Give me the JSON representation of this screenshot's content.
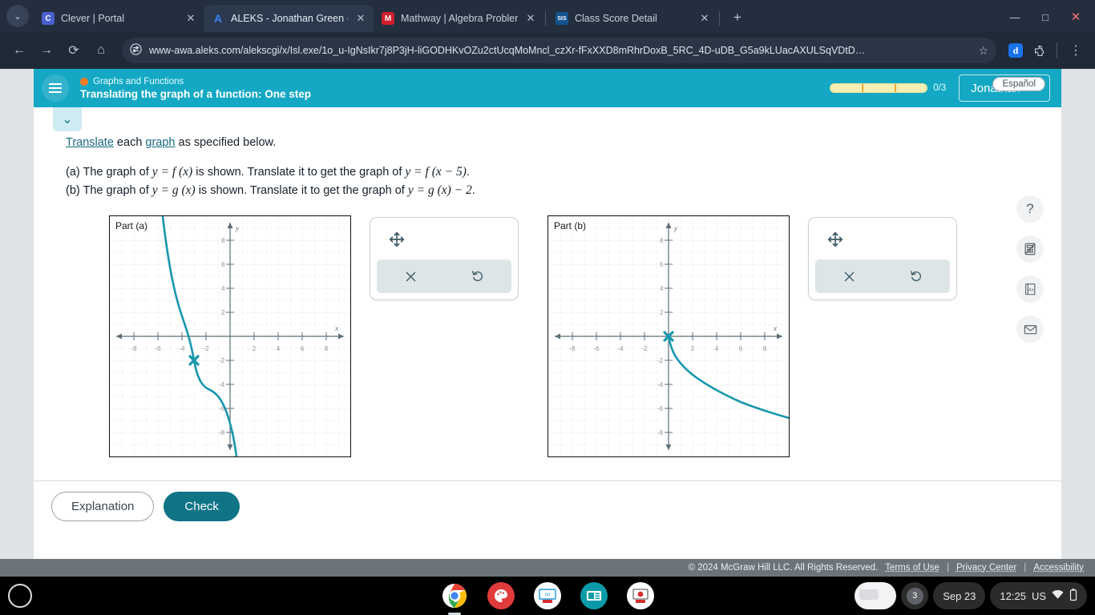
{
  "browser": {
    "tabs": [
      {
        "title": "Clever | Portal",
        "favicon_letter": "C",
        "favicon_color": "#4a5fd0",
        "active": false
      },
      {
        "title": "ALEKS - Jonathan Green - Lear",
        "favicon_letter": "A",
        "favicon_color": "#2b3a4d",
        "active": true
      },
      {
        "title": "Mathway | Algebra Problem So",
        "favicon_letter": "M",
        "favicon_color": "#d11f2b",
        "active": false
      },
      {
        "title": "Class Score Detail",
        "favicon_letter": "SIS",
        "favicon_color": "#12538f",
        "active": false
      }
    ],
    "new_tab_label": "+",
    "nav": {
      "back": "←",
      "forward": "→",
      "reload": "⟳",
      "home": "⌂"
    },
    "url": "www-awa.aleks.com/alekscgi/x/Isl.exe/1o_u-IgNsIkr7j8P3jH-liGODHKvOZu2ctUcqMoMncl_czXr-fFxXXD8mRhrDoxB_5RC_4D-uDB_G5a9kLUacAXULSqVDtD…",
    "bookmark_label": "☆",
    "extension_label": "d",
    "menu_label": "⋮",
    "window_controls": {
      "minimize": "—",
      "maximize": "□",
      "close": "✕"
    }
  },
  "aleks": {
    "topic": "Graphs and Functions",
    "lesson": "Translating the graph of a function: One step",
    "progress": {
      "count_label": "0/3",
      "segments": 3,
      "filled": 0
    },
    "user": "Jonathan",
    "espanol": "Español",
    "collapse_icon": "⌄",
    "question": {
      "intro_link1": "Translate",
      "intro_mid": " each ",
      "intro_link2": "graph",
      "intro_end": " as specified below.",
      "part_a": {
        "marker": "(a) ",
        "text1": "The graph of ",
        "eq1": "y = f (x)",
        "text2": " is shown. Translate it to get the graph of ",
        "eq2": "y = f (x − 5)",
        "end": "."
      },
      "part_b": {
        "marker": "(b) ",
        "text1": "The graph of ",
        "eq1": "y = g (x)",
        "text2": " is shown. Translate it to get the graph of ",
        "eq2": "y = g (x) − 2",
        "end": "."
      }
    },
    "graphs": [
      {
        "label": "Part (a)"
      },
      {
        "label": "Part (b)"
      }
    ],
    "tool_panels": [
      {
        "move_icon": "move-icon",
        "clear_icon": "✕",
        "undo_icon": "↺"
      },
      {
        "move_icon": "move-icon",
        "clear_icon": "✕",
        "undo_icon": "↺"
      }
    ],
    "side_tools": [
      {
        "name": "help-icon",
        "glyph": "?"
      },
      {
        "name": "calculator-disabled-icon",
        "glyph": ""
      },
      {
        "name": "dictionary-icon",
        "glyph": "Aa"
      },
      {
        "name": "mail-icon",
        "glyph": "✉"
      }
    ],
    "buttons": {
      "explanation": "Explanation",
      "check": "Check"
    },
    "footer": {
      "copyright": "© 2024 McGraw Hill LLC. All Rights Reserved.",
      "links": [
        "Terms of Use",
        "Privacy Center",
        "Accessibility"
      ],
      "separator": "|"
    },
    "colors": {
      "header": "#14a8c4",
      "curve": "#1797ad",
      "check_button": "#0f7486",
      "topic_dot": "#f57c20"
    }
  },
  "shelf": {
    "apps": [
      "chrome-icon",
      "paint-icon",
      "presentation-icon",
      "media-icon",
      "record-icon"
    ],
    "notification_count": "3",
    "date": "Sep 23",
    "time": "12:25",
    "locale": "US",
    "wifi_icon": "wifi-icon",
    "battery_icon": "battery-icon"
  },
  "chart_data": [
    {
      "type": "line",
      "title": "Part (a)",
      "xlabel": "x",
      "ylabel": "y",
      "xlim": [
        -9.5,
        9.5
      ],
      "ylim": [
        -9.5,
        9.5
      ],
      "xticks": [
        -8,
        -6,
        -4,
        -2,
        2,
        4,
        6,
        8
      ],
      "yticks": [
        -8,
        -6,
        -4,
        -2,
        2,
        4,
        6,
        8
      ],
      "grid": true,
      "description": "Decreasing cubic y = f(x) with inflection point marked by an X at (-3, -2); falls steeply from upper-left, flattens near (-3,-2), then falls steeply again to lower-right.",
      "marker_points": [
        [
          -3,
          -2
        ]
      ],
      "series": [
        {
          "name": "y = f(x)",
          "points": [
            [
              -5.6,
              9.5
            ],
            [
              -5.2,
              7.2
            ],
            [
              -4.8,
              5.0
            ],
            [
              -4.4,
              3.2
            ],
            [
              -4.0,
              1.6
            ],
            [
              -3.6,
              0.2
            ],
            [
              -3.3,
              -1.0
            ],
            [
              -3.0,
              -2.0
            ],
            [
              -2.7,
              -2.5
            ],
            [
              -2.4,
              -2.8
            ],
            [
              -2.0,
              -3.2
            ],
            [
              -1.6,
              -3.9
            ],
            [
              -1.2,
              -4.8
            ],
            [
              -0.8,
              -6.0
            ],
            [
              -0.5,
              -7.2
            ],
            [
              -0.2,
              -8.6
            ],
            [
              0.0,
              -9.5
            ]
          ]
        }
      ]
    },
    {
      "type": "line",
      "title": "Part (b)",
      "xlabel": "x",
      "ylabel": "y",
      "xlim": [
        -9.5,
        9.5
      ],
      "ylim": [
        -9.5,
        9.5
      ],
      "xticks": [
        -8,
        -6,
        -4,
        -2,
        2,
        4,
        6,
        8
      ],
      "yticks": [
        -8,
        -6,
        -4,
        -2,
        2,
        4,
        6,
        8
      ],
      "grid": true,
      "description": "Negative square-root curve y = g(x) = -2*sqrt(x) starting at the origin (0,0) marked with an X, descending to the right to about (9.5, -6.2).",
      "marker_points": [
        [
          0,
          0
        ]
      ],
      "series": [
        {
          "name": "y = g(x)",
          "points": [
            [
              0,
              0
            ],
            [
              0.25,
              -1.0
            ],
            [
              0.5,
              -1.4
            ],
            [
              1,
              -2.0
            ],
            [
              1.5,
              -2.45
            ],
            [
              2,
              -2.83
            ],
            [
              3,
              -3.46
            ],
            [
              4,
              -4.0
            ],
            [
              5,
              -4.47
            ],
            [
              6,
              -4.9
            ],
            [
              7,
              -5.29
            ],
            [
              8,
              -5.66
            ],
            [
              9,
              -6.0
            ],
            [
              9.5,
              -6.2
            ]
          ]
        }
      ]
    }
  ]
}
